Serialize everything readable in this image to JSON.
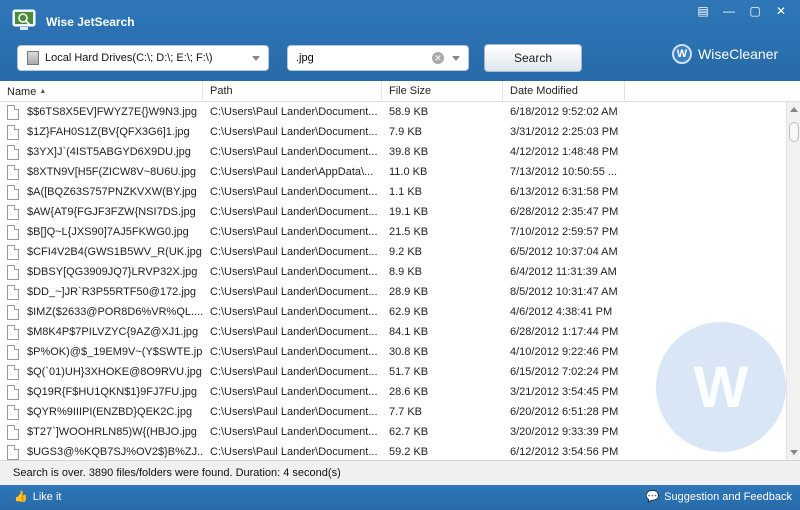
{
  "app": {
    "title": "Wise JetSearch",
    "brand": "WiseCleaner",
    "brand_mark": "W"
  },
  "window_controls": [
    {
      "name": "menu-icon",
      "glyph": "▤"
    },
    {
      "name": "minimize-icon",
      "glyph": "—"
    },
    {
      "name": "maximize-icon",
      "glyph": "▢"
    },
    {
      "name": "close-icon",
      "glyph": "✕"
    }
  ],
  "search": {
    "drive_label": "Local Hard Drives(C:\\; D:\\; E:\\; F:\\)",
    "query_value": ".jpg",
    "button_label": "Search"
  },
  "columns": [
    "Name",
    "Path",
    "File Size",
    "Date Modified"
  ],
  "rows": [
    {
      "name": "$$6TS8X5EV]FWYZ7E{}W9N3.jpg",
      "path": "C:\\Users\\Paul Lander\\Document...",
      "size": "58.9 KB",
      "date": "6/18/2012 9:52:02 AM"
    },
    {
      "name": "$1Z}FAH0S1Z(BV{QFX3G6]1.jpg",
      "path": "C:\\Users\\Paul Lander\\Document...",
      "size": "7.9 KB",
      "date": "3/31/2012 2:25:03 PM"
    },
    {
      "name": "$3YX]J`(4IST5ABGYD6X9DU.jpg",
      "path": "C:\\Users\\Paul Lander\\Document...",
      "size": "39.8 KB",
      "date": "4/12/2012 1:48:48 PM"
    },
    {
      "name": "$8XTN9V[H5F(ZICW8V~8U6U.jpg",
      "path": "C:\\Users\\Paul Lander\\AppData\\...",
      "size": "11.0 KB",
      "date": "7/13/2012 10:50:55 ..."
    },
    {
      "name": "$A([BQZ63S757PNZKVXW(BY.jpg",
      "path": "C:\\Users\\Paul Lander\\Document...",
      "size": "1.1 KB",
      "date": "6/13/2012 6:31:58 PM"
    },
    {
      "name": "$AW{AT9{FGJF3FZW{NSI7DS.jpg",
      "path": "C:\\Users\\Paul Lander\\Document...",
      "size": "19.1 KB",
      "date": "6/28/2012 2:35:47 PM"
    },
    {
      "name": "$B[]Q~L{JXS90]7AJ5FKWG0.jpg",
      "path": "C:\\Users\\Paul Lander\\Document...",
      "size": "21.5 KB",
      "date": "7/10/2012 2:59:57 PM"
    },
    {
      "name": "$CFI4V2B4(GWS1B5WV_R(UK.jpg",
      "path": "C:\\Users\\Paul Lander\\Document...",
      "size": "9.2 KB",
      "date": "6/5/2012 10:37:04 AM"
    },
    {
      "name": "$DBSY[QG3909JQ7}LRVP32X.jpg",
      "path": "C:\\Users\\Paul Lander\\Document...",
      "size": "8.9 KB",
      "date": "6/4/2012 11:31:39 AM"
    },
    {
      "name": "$DD_~]JR`R3P55RTF50@172.jpg",
      "path": "C:\\Users\\Paul Lander\\Document...",
      "size": "28.9 KB",
      "date": "8/5/2012 10:31:47 AM"
    },
    {
      "name": "$IMZ($2633@POR8D6%VR%QL....",
      "path": "C:\\Users\\Paul Lander\\Document...",
      "size": "62.9 KB",
      "date": "4/6/2012 4:38:41 PM"
    },
    {
      "name": "$M8K4P$7PILVZYC{9AZ@XJ1.jpg",
      "path": "C:\\Users\\Paul Lander\\Document...",
      "size": "84.1 KB",
      "date": "6/28/2012 1:17:44 PM"
    },
    {
      "name": "$P%OK)@$_19EM9V~(Y$SWTE.jpg",
      "path": "C:\\Users\\Paul Lander\\Document...",
      "size": "30.8 KB",
      "date": "4/10/2012 9:22:46 PM"
    },
    {
      "name": "$Q(`01)UH}3XHOKE@8O9RVU.jpg",
      "path": "C:\\Users\\Paul Lander\\Document...",
      "size": "51.7 KB",
      "date": "6/15/2012 7:02:24 PM"
    },
    {
      "name": "$Q19R{F$HU1QKN$1}9FJ7FU.jpg",
      "path": "C:\\Users\\Paul Lander\\Document...",
      "size": "28.6 KB",
      "date": "3/21/2012 3:54:45 PM"
    },
    {
      "name": "$QYR%9IIIPI(ENZBD}QEK2C.jpg",
      "path": "C:\\Users\\Paul Lander\\Document...",
      "size": "7.7 KB",
      "date": "6/20/2012 6:51:28 PM"
    },
    {
      "name": "$T27`]WOOHRLN85)W{(HBJO.jpg",
      "path": "C:\\Users\\Paul Lander\\Document...",
      "size": "62.7 KB",
      "date": "3/20/2012 9:33:39 PM"
    },
    {
      "name": "$UGS3@%KQB7SJ%OV2$}B%ZJ...",
      "path": "C:\\Users\\Paul Lander\\Document...",
      "size": "59.2 KB",
      "date": "6/12/2012 3:54:56 PM"
    }
  ],
  "status": "Search is over. 3890 files/folders were found. Duration: 4 second(s)",
  "footer": {
    "like_label": "Like it",
    "feedback_label": "Suggestion and Feedback"
  },
  "watermark": "W"
}
